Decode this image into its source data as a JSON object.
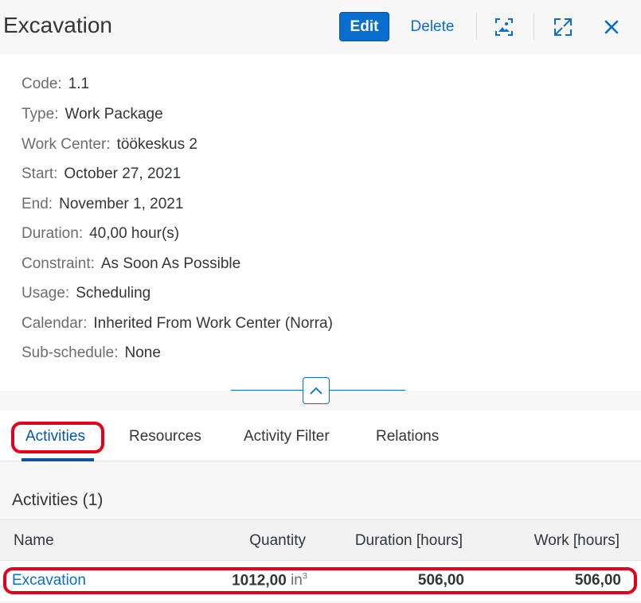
{
  "header": {
    "title": "Excavation",
    "edit_label": "Edit",
    "delete_label": "Delete"
  },
  "details": [
    {
      "label": "Code:",
      "value": "1.1"
    },
    {
      "label": "Type:",
      "value": "Work Package"
    },
    {
      "label": "Work Center:",
      "value": "töökeskus 2"
    },
    {
      "label": "Start:",
      "value": "October 27, 2021"
    },
    {
      "label": "End:",
      "value": "November 1, 2021"
    },
    {
      "label": "Duration:",
      "value": "40,00 hour(s)"
    },
    {
      "label": "Constraint:",
      "value": "As Soon As Possible"
    },
    {
      "label": "Usage:",
      "value": "Scheduling"
    },
    {
      "label": "Calendar:",
      "value": "Inherited From Work Center (Norra)"
    },
    {
      "label": "Sub-schedule:",
      "value": "None"
    }
  ],
  "tabs": [
    {
      "label": "Activities"
    },
    {
      "label": "Resources"
    },
    {
      "label": "Activity Filter"
    },
    {
      "label": "Relations"
    }
  ],
  "activities": {
    "title": "Activities (1)",
    "columns": [
      "Name",
      "Quantity",
      "Duration [hours]",
      "Work [hours]"
    ],
    "rows": [
      {
        "name": "Excavation",
        "quantity": "1012,00",
        "unit": "in",
        "unit_exp": "3",
        "duration": "506,00",
        "work": "506,00"
      }
    ]
  },
  "colors": {
    "accent": "#0a6ed1",
    "highlight": "#e2001a"
  }
}
